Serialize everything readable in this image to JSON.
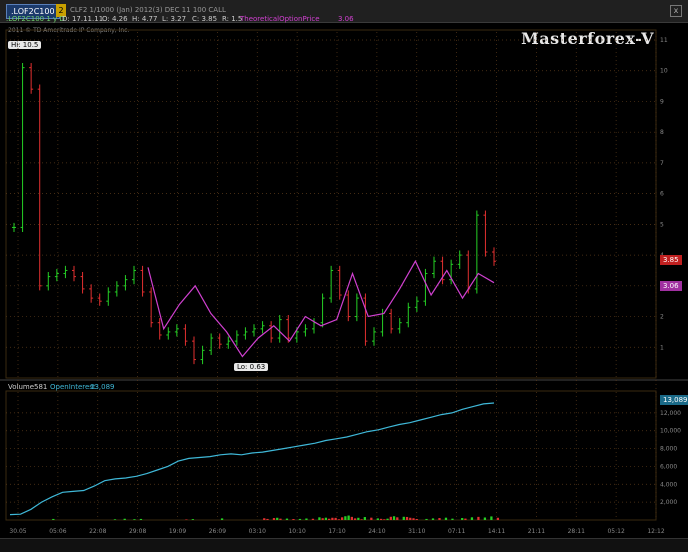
{
  "toolbar": {
    "symbol": ".LOF2C100",
    "badge": "2",
    "description": "CLF2 1/1000 (Jan) 2012(3) DEC 11 100 CALL",
    "close_glyph": "x"
  },
  "infobar": {
    "symbol": ".LOF2C100 1 y D",
    "date": "D: 17.11.11",
    "open": "O: 4.26",
    "high": "H: 4.77",
    "low": "L: 3.27",
    "close": "C: 3.85",
    "range": "R: 1.5",
    "study_label": "TheoreticalOptionPrice",
    "study_value": "3.06"
  },
  "copyright": "2011 © TD Ameritrade IP Company, Inc.",
  "watermark": "Masterforex-V",
  "hi_label": "Hi: 10.5",
  "lo_label": "Lo: 0.63",
  "price_tags": {
    "last": "3.85",
    "theoretical": "3.06"
  },
  "colors": {
    "up": "#25d025",
    "down": "#e23030",
    "theoretical": "#d040d0",
    "oi": "#3fb8d8",
    "grid": "#5a3a1a"
  },
  "volume_legend": {
    "volume_label": "Volume",
    "volume_value": "581",
    "oi_label": "OpenInterest",
    "oi_value": "13,089"
  },
  "oi_tag": "13,089",
  "bottom_ticks": [
    "30.05",
    "05:06",
    "22:08",
    "29:08",
    "19:09",
    "26:09",
    "03:10",
    "10:10",
    "17:10",
    "24:10",
    "31:10",
    "07:11",
    "14:11",
    "21:11",
    "28:11",
    "05:12",
    "12:12"
  ],
  "chart_data": [
    {
      "type": "line",
      "title": "",
      "x": [
        "30.05",
        "05:06",
        "22:08",
        "29:08",
        "19:09",
        "26:09",
        "03:10",
        "10:10",
        "17:10",
        "24:10",
        "31:10",
        "07:11",
        "14:11"
      ],
      "y_axis_ticks": [
        "1",
        "2",
        "3",
        "4",
        "5",
        "6",
        "7",
        "8",
        "9",
        "10",
        "11"
      ],
      "ylim": [
        0,
        11
      ],
      "series": [
        {
          "name": "TheoreticalOptionPrice",
          "values": [
            3.6,
            1.6,
            2.4,
            3.0,
            2.1,
            1.5,
            0.7,
            1.3,
            1.7,
            1.2,
            2.0,
            1.7,
            1.9,
            3.4,
            2.0,
            2.1,
            2.9,
            3.8,
            2.7,
            3.5,
            2.6,
            3.4,
            3.1
          ]
        }
      ],
      "ohlc_close": [
        4.9,
        10.1,
        9.4,
        3.0,
        3.3,
        3.4,
        3.5,
        3.3,
        2.9,
        2.6,
        2.5,
        2.8,
        3.0,
        3.2,
        3.5,
        2.8,
        1.8,
        1.4,
        1.5,
        1.6,
        1.2,
        0.6,
        0.9,
        1.3,
        1.1,
        1.2,
        1.4,
        1.5,
        1.6,
        1.7,
        1.3,
        1.9,
        1.3,
        1.5,
        1.6,
        1.8,
        2.6,
        3.5,
        2.7,
        2.0,
        2.6,
        1.2,
        1.5,
        2.1,
        1.6,
        1.8,
        2.3,
        2.5,
        3.4,
        3.8,
        3.2,
        3.7,
        4.0,
        2.9,
        5.3,
        4.1,
        3.8
      ]
    },
    {
      "type": "bar",
      "title": "",
      "y_axis_ticks": [
        "2,000",
        "4,000",
        "6,000",
        "8,000",
        "10,000",
        "12,000"
      ],
      "ylim": [
        0,
        14000
      ],
      "series": [
        {
          "name": "Volume",
          "values": [
            0,
            0,
            0,
            0,
            0,
            0,
            0,
            0,
            0,
            0,
            0,
            0,
            0,
            120,
            0,
            0,
            0,
            0,
            0,
            0,
            0,
            0,
            0,
            0,
            0,
            0,
            0,
            0,
            0,
            0,
            0,
            0,
            80,
            0,
            0,
            140,
            0,
            0,
            90,
            0,
            120,
            0,
            0,
            0,
            0,
            0,
            0,
            0,
            0,
            0,
            0,
            0,
            0,
            0,
            60,
            0,
            100,
            0,
            0,
            0,
            0,
            0,
            0,
            0,
            0,
            180,
            0,
            0,
            0,
            0,
            0,
            0,
            0,
            0,
            0,
            0,
            0,
            0,
            200,
            120,
            0,
            220,
            250,
            150,
            0,
            160,
            0,
            110,
            0,
            120,
            0,
            170,
            0,
            140,
            0,
            300,
            200,
            260,
            140,
            250,
            240,
            80,
            300,
            420,
            500,
            350,
            180,
            250,
            80,
            330,
            0,
            260,
            0,
            180,
            130,
            80,
            150,
            360,
            420,
            300,
            0,
            360,
            340,
            250,
            200,
            110,
            0,
            0,
            120,
            0,
            180,
            0,
            220,
            0,
            260,
            0,
            150,
            0,
            0,
            220,
            160,
            0,
            300,
            0,
            350,
            0,
            280,
            0,
            400,
            0,
            250
          ]
        },
        {
          "name": "OpenInterest",
          "values": [
            600,
            650,
            1200,
            2000,
            2600,
            3100,
            3200,
            3300,
            3800,
            4400,
            4600,
            4700,
            4900,
            5200,
            5600,
            6000,
            6600,
            6900,
            7000,
            7100,
            7300,
            7400,
            7300,
            7500,
            7600,
            7800,
            8000,
            8200,
            8400,
            8600,
            8900,
            9100,
            9300,
            9600,
            9900,
            10100,
            10400,
            10700,
            10900,
            11200,
            11500,
            11800,
            12000,
            12400,
            12700,
            13000,
            13100
          ]
        }
      ]
    }
  ]
}
